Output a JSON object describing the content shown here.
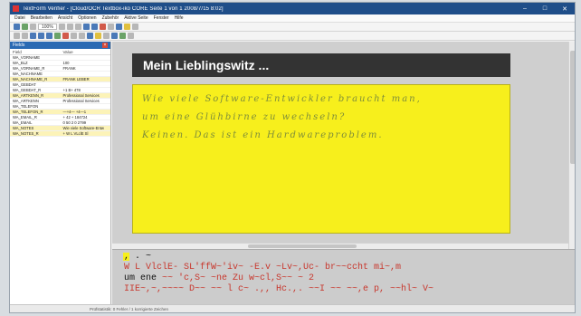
{
  "window": {
    "title": "TextForm Verifier - [Cloud/OCR Textbox-iko CORE Seite 1 von 1 2008/7/15 8:02]"
  },
  "menu": [
    "Datei",
    "Bearbeiten",
    "Ansicht",
    "Optionen",
    "Zubehör",
    "Aktive Seite",
    "Fenster",
    "Hilfe"
  ],
  "toolbar": {
    "zoom": "100%"
  },
  "panel": {
    "title": "Fields",
    "columns": [
      "Field",
      "Value"
    ],
    "rows": [
      {
        "field": "WA_VORNAME",
        "value": "",
        "hl": false
      },
      {
        "field": "WA_BLZ",
        "value": "100",
        "hl": false
      },
      {
        "field": "WA_VORNAME_R",
        "value": "FRANK",
        "hl": false
      },
      {
        "field": "WA_NACHNAME",
        "value": "",
        "hl": false
      },
      {
        "field": "WA_NACHNAME_R",
        "value": "FRANK LEBER",
        "hl": true
      },
      {
        "field": "WA_GEBDAT",
        "value": "",
        "hl": false
      },
      {
        "field": "WA_GEBDAT_R",
        "value": "+1 B+ 478",
        "hl": false
      },
      {
        "field": "WA_ARTKENN_R",
        "value": "Professional Services",
        "hl": true
      },
      {
        "field": "WA_ARTKENN",
        "value": "Professional Services",
        "hl": false
      },
      {
        "field": "WA_TELEFON",
        "value": "",
        "hl": false
      },
      {
        "field": "WA_TELEFON_R",
        "value": "—+4— +4—1",
        "hl": true
      },
      {
        "field": "WA_EMAIL_R",
        "value": "+ 42 + 184724",
        "hl": false
      },
      {
        "field": "WA_EMAIL",
        "value": "0 50 2 0 2799",
        "hl": false
      },
      {
        "field": "WA_NOTES",
        "value": "Wie viele Software-Entw",
        "hl": true
      },
      {
        "field": "WA_NOTES_R",
        "value": "+ W L VLclE Sl",
        "hl": true
      }
    ]
  },
  "document": {
    "header": "Mein Lieblingswitz ...",
    "handwriting": [
      "Wie viele Software-Entwickler braucht man,",
      "um eine Glühbirne zu wechseln?",
      "Keinen. Das ist ein Hardwareproblem."
    ]
  },
  "ocr": {
    "line0": ", . ~",
    "line1": "W L VlclE- SL'ffW~'iv~ -E.v ~Lv~,Uc- br~~ccht mi~,m",
    "line2a": "um ene",
    "line2b": " ~~ 'c,S~ ~ne Zu w~cl,S~~ ~ 2",
    "line3": "IIE~,~,~~~~ D~~ ~~ l c~ .,, Hc.,. ~~I ~~ ~~,e p, ~~hl~ V~"
  },
  "status": [
    "",
    "",
    "Prüfstatistik: 0 Fehler / 1 korrigierte Zeichen"
  ],
  "colors": {
    "doc_bg": "#f7ef1c",
    "ocr_error": "#c8372d",
    "title_bar": "#1f4e89"
  }
}
